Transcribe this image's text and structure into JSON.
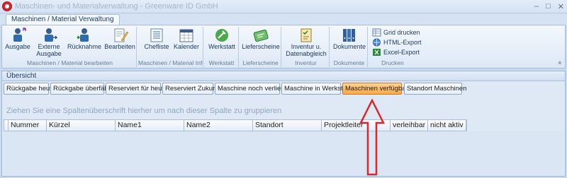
{
  "window": {
    "title": "Maschinen- und Materialverwaltung - Greenware ID GmbH",
    "controls": [
      "–",
      "□",
      "✕"
    ]
  },
  "ribbon": {
    "tab": "Maschinen / Material Verwaltung",
    "groups": [
      {
        "label": "Maschinen / Material bearbeiten",
        "buttons": [
          {
            "label": "Ausgabe",
            "icon": "worker-out-icon"
          },
          {
            "label": "Externe Ausgabe",
            "icon": "worker-external-icon"
          },
          {
            "label": "Rücknahme",
            "icon": "worker-return-icon"
          },
          {
            "label": "Bearbeiten",
            "icon": "edit-document-icon"
          }
        ]
      },
      {
        "label": "Maschinen / Material Info",
        "buttons": [
          {
            "label": "Chefliste",
            "icon": "list-icon"
          },
          {
            "label": "Kalender",
            "icon": "calendar-icon"
          }
        ]
      },
      {
        "label": "Werkstatt",
        "buttons": [
          {
            "label": "Werkstatt",
            "icon": "workshop-icon"
          }
        ]
      },
      {
        "label": "Lieferscheine",
        "buttons": [
          {
            "label": "Lieferscheine",
            "icon": "delivery-note-icon"
          }
        ]
      },
      {
        "label": "Inventur",
        "buttons": [
          {
            "label": "Inventur u. Datenabgleich",
            "icon": "inventory-icon"
          }
        ]
      },
      {
        "label": "Dokumente",
        "buttons": [
          {
            "label": "Dokumente",
            "icon": "binders-icon"
          }
        ]
      },
      {
        "label": "Drucken",
        "small_buttons": [
          {
            "label": "Grid drucken",
            "icon": "grid-print-icon"
          },
          {
            "label": "HTML-Export",
            "icon": "html-export-icon"
          },
          {
            "label": "Excel-Export",
            "icon": "excel-export-icon"
          }
        ]
      }
    ],
    "collapse_icon": "«"
  },
  "panel": {
    "title": "Übersicht",
    "filter_buttons": [
      "Rückgabe heute",
      "Rückgabe überfällig",
      "Reserviert für heute",
      "Reserviert Zukunft",
      "Maschine noch verliehen",
      "Maschine in Werkstatt",
      "Maschinen verfügbar",
      "Standort Maschinen"
    ],
    "active_filter": "Maschinen verfügbar",
    "group_hint": "Ziehen Sie eine Spaltenüberschrift hierher um nach dieser Spalte zu gruppieren",
    "columns": [
      "Nummer",
      "Kürzel",
      "Name1",
      "Name2",
      "Standort",
      "Projektleiter",
      "verleihbar",
      "nicht aktiv"
    ]
  },
  "colors": {
    "active_button": "#f7a94a",
    "arrow": "#d9262b"
  }
}
